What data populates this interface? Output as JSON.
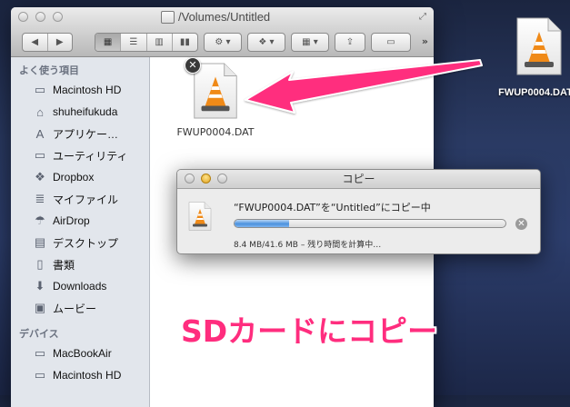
{
  "desktop": {
    "file_label": "FWUP0004.DAT"
  },
  "finder": {
    "title": "/Volumes/Untitled",
    "sidebar": {
      "favorites_title": "よく使う項目",
      "favorites": [
        {
          "label": "Macintosh HD",
          "icon": "hard-disk-icon"
        },
        {
          "label": "shuheifukuda",
          "icon": "home-icon"
        },
        {
          "label": "アプリケー…",
          "icon": "applications-icon"
        },
        {
          "label": "ユーティリティ",
          "icon": "folder-icon"
        },
        {
          "label": "Dropbox",
          "icon": "dropbox-icon"
        },
        {
          "label": "マイファイル",
          "icon": "all-files-icon"
        },
        {
          "label": "AirDrop",
          "icon": "airdrop-icon"
        },
        {
          "label": "デスクトップ",
          "icon": "desktop-icon"
        },
        {
          "label": "書類",
          "icon": "documents-icon"
        },
        {
          "label": "Downloads",
          "icon": "downloads-icon"
        },
        {
          "label": "ムービー",
          "icon": "movies-icon"
        }
      ],
      "devices_title": "デバイス",
      "devices": [
        {
          "label": "MacBookAir",
          "icon": "laptop-icon"
        },
        {
          "label": "Macintosh HD",
          "icon": "hard-disk-icon"
        }
      ]
    },
    "content": {
      "file_label": "FWUP0004.DAT"
    }
  },
  "copy_dialog": {
    "title": "コピー",
    "message": "“FWUP0004.DAT”を“Untitled”にコピー中",
    "status": "8.4 MB/41.6 MB – 残り時間を計算中…",
    "progress_fraction": 0.202
  },
  "annotation": {
    "text": "SDカードにコピー",
    "color": "#ff2d7e"
  },
  "colors": {
    "accent_pink": "#ff2d7e",
    "progress_blue": "#4b91de"
  }
}
